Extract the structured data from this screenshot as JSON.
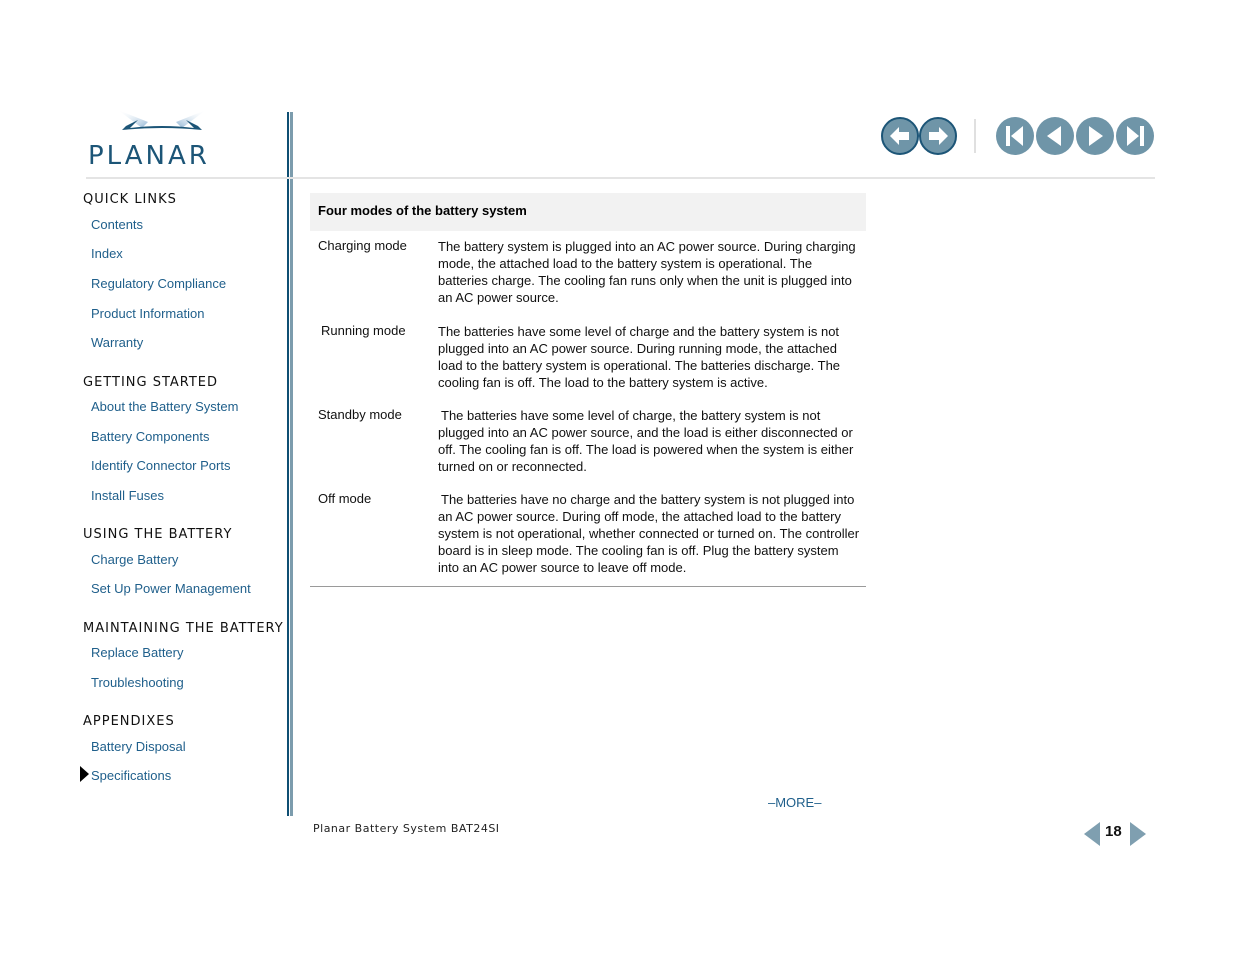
{
  "brand": {
    "logo_text": "PLANAR",
    "logo_color": "#1c5577",
    "accent_light": "#7c9cad"
  },
  "toolbar": {
    "buttons": [
      {
        "name": "back",
        "icon": "arrow-left-icon"
      },
      {
        "name": "forward",
        "icon": "arrow-right-icon"
      },
      {
        "name": "first-page",
        "icon": "skip-first-icon"
      },
      {
        "name": "previous-page",
        "icon": "triangle-left-icon"
      },
      {
        "name": "next-page",
        "icon": "triangle-right-icon"
      },
      {
        "name": "last-page",
        "icon": "skip-last-icon"
      }
    ],
    "button_color": "#6f95a8"
  },
  "sidebar": {
    "link_color": "#1f5f8b",
    "sections": [
      {
        "heading": "QUICK LINKS",
        "links": [
          "Contents",
          "Index",
          "Regulatory Compliance",
          "Product Information",
          "Warranty"
        ]
      },
      {
        "heading": "GETTING STARTED",
        "links": [
          "About the Battery System",
          "Battery Components",
          "Identify Connector Ports",
          "Install Fuses"
        ]
      },
      {
        "heading": "USING THE BATTERY",
        "links": [
          "Charge Battery",
          "Set Up Power Management"
        ]
      },
      {
        "heading": "MAINTAINING THE BATTERY",
        "links": [
          "Replace Battery",
          "Troubleshooting"
        ]
      },
      {
        "heading": "APPENDIXES",
        "links": [
          "Battery Disposal",
          "Specifications"
        ]
      }
    ],
    "current": "Specifications"
  },
  "main": {
    "table": {
      "title": "Four modes of the battery system",
      "rows": [
        {
          "mode": "Charging mode",
          "description": "The battery system is plugged into an AC power source. During charging mode, the attached load to the battery system is operational. The batteries charge. The cooling fan runs only when the unit is plugged into an AC power source."
        },
        {
          "mode": "Running mode",
          "description": "The batteries have some level of charge and the battery system is not plugged into an AC power source. During running mode, the attached load to the battery system is operational. The batteries discharge. The cooling fan is off. The load to the battery system is active."
        },
        {
          "mode": "Standby mode",
          "description": "The batteries have some level of charge, the battery system is not plugged into an AC power source, and the load is either disconnected or off. The cooling fan is off. The load is powered when the system is either turned on or reconnected."
        },
        {
          "mode": "Off mode",
          "description": "The batteries have no charge and the battery system is not plugged into an AC power source. During off mode, the attached load to the battery system is not operational, whether connected or turned on. The controller board is in sleep mode. The cooling fan is off. Plug the battery system into an AC power source to leave off mode."
        }
      ]
    },
    "more_label": "–MORE–"
  },
  "footer": {
    "doc_title": "Planar Battery System BAT24SI",
    "page_number": "18"
  }
}
